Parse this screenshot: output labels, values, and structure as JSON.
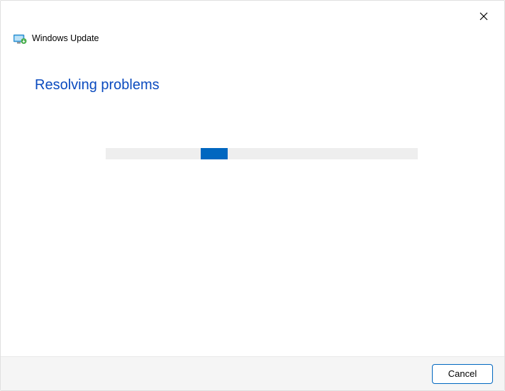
{
  "header": {
    "title": "Windows Update"
  },
  "main": {
    "heading": "Resolving problems"
  },
  "footer": {
    "cancel_label": "Cancel"
  }
}
